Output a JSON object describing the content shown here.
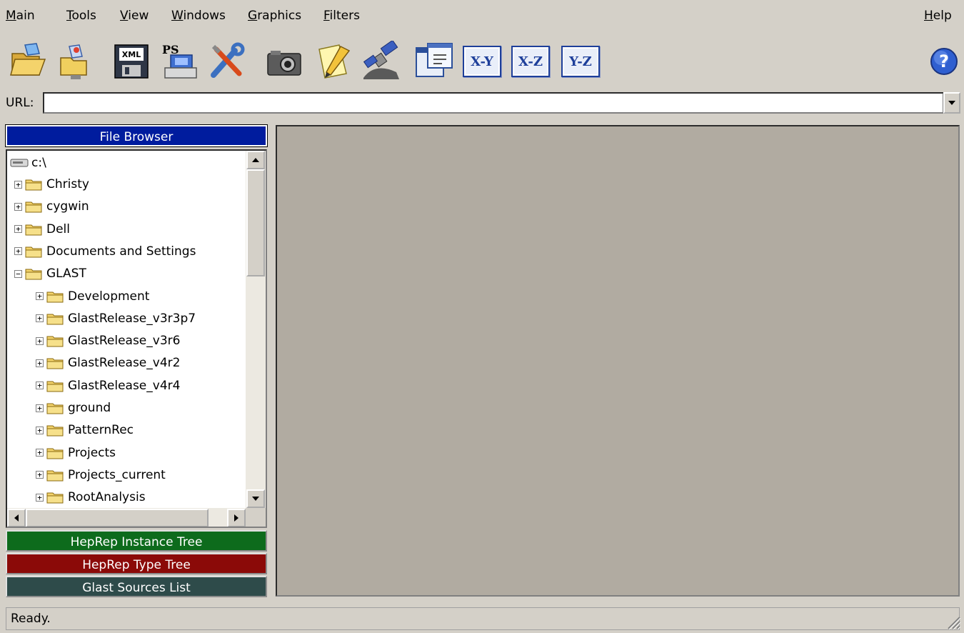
{
  "menu": {
    "main": "Main",
    "tools": "Tools",
    "view": "View",
    "windows": "Windows",
    "graphics": "Graphics",
    "filters": "Filters",
    "help": "Help"
  },
  "toolbar": {
    "icons": [
      "open-folder-icon",
      "open-network-icon",
      "save-xml-icon",
      "print-ps-icon",
      "tools-icon",
      "camera-icon",
      "notepad-icon",
      "satellite-icon",
      "window-config-icon"
    ],
    "xy": "X-Y",
    "xz": "X-Z",
    "yz": "Y-Z",
    "help_icon": "help-icon"
  },
  "url": {
    "label": "URL:",
    "value": ""
  },
  "panels": {
    "file_browser": "File Browser",
    "instance_tree": "HepRep Instance Tree",
    "type_tree": "HepRep Type Tree",
    "glast_sources": "Glast Sources List"
  },
  "tree": {
    "root": "c:\\",
    "items": [
      {
        "label": "Christy",
        "level": 1,
        "expanded": false
      },
      {
        "label": "cygwin",
        "level": 1,
        "expanded": false
      },
      {
        "label": "Dell",
        "level": 1,
        "expanded": false
      },
      {
        "label": "Documents and Settings",
        "level": 1,
        "expanded": false
      },
      {
        "label": "GLAST",
        "level": 1,
        "expanded": true
      },
      {
        "label": "Development",
        "level": 2,
        "expanded": false
      },
      {
        "label": "GlastRelease_v3r3p7",
        "level": 2,
        "expanded": false
      },
      {
        "label": "GlastRelease_v3r6",
        "level": 2,
        "expanded": false
      },
      {
        "label": "GlastRelease_v4r2",
        "level": 2,
        "expanded": false
      },
      {
        "label": "GlastRelease_v4r4",
        "level": 2,
        "expanded": false
      },
      {
        "label": "ground",
        "level": 2,
        "expanded": false
      },
      {
        "label": "PatternRec",
        "level": 2,
        "expanded": false
      },
      {
        "label": "Projects",
        "level": 2,
        "expanded": false
      },
      {
        "label": "Projects_current",
        "level": 2,
        "expanded": false
      },
      {
        "label": "RootAnalysis",
        "level": 2,
        "expanded": false
      }
    ]
  },
  "status": {
    "text": "Ready."
  }
}
